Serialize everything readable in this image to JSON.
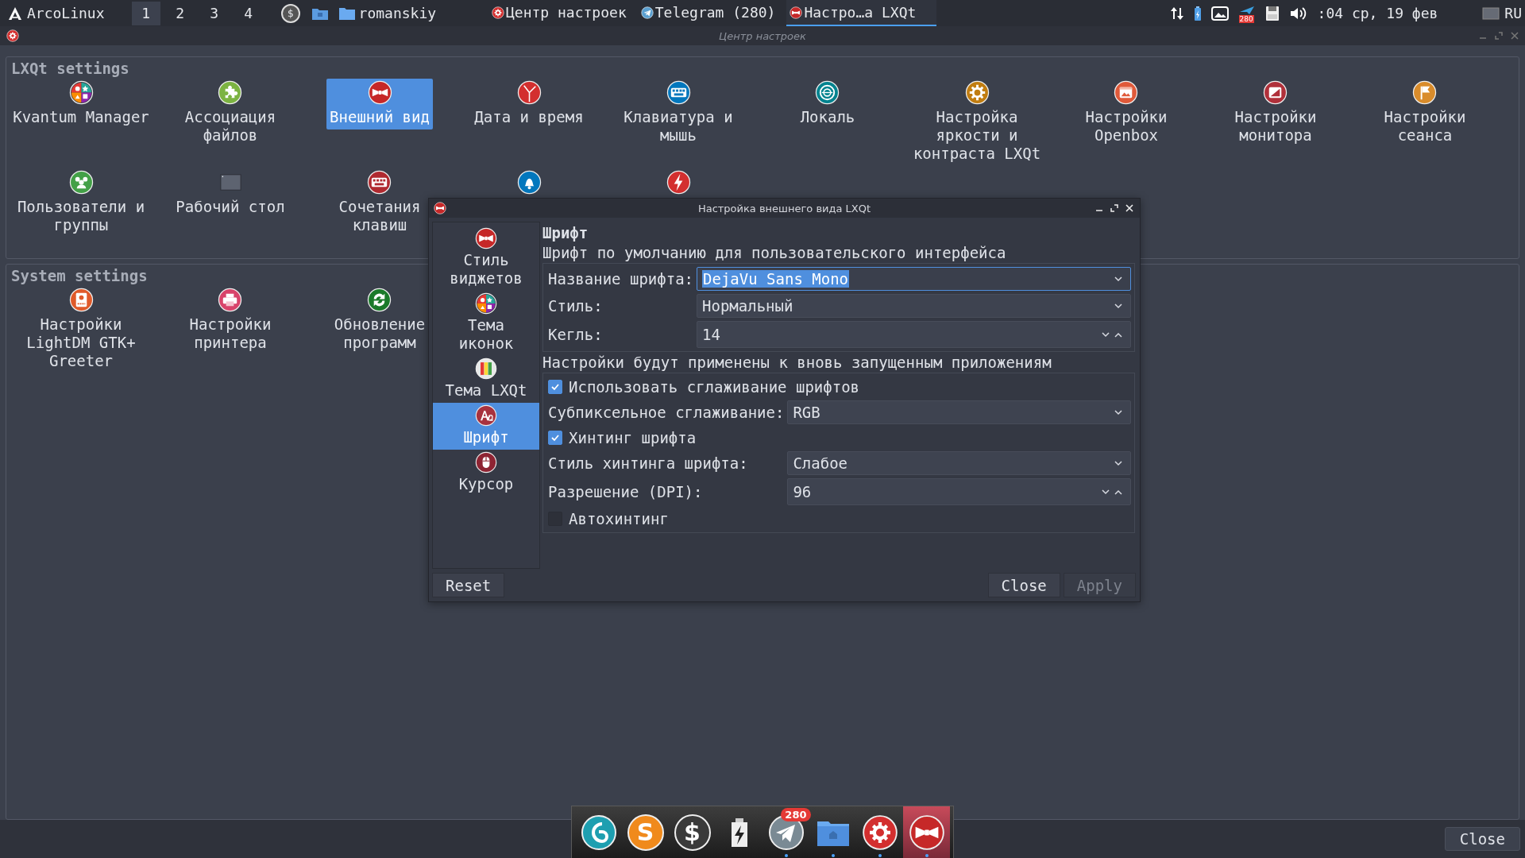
{
  "top_panel": {
    "launcher": "ArcoLinux",
    "workspaces": [
      {
        "label": "1",
        "selected": true
      },
      {
        "label": "2",
        "selected": false
      },
      {
        "label": "3",
        "selected": false
      },
      {
        "label": "4",
        "selected": false
      }
    ],
    "quick_launch": [
      {
        "kind": "terminal",
        "glyph": "$"
      },
      {
        "kind": "folder"
      }
    ],
    "folder": "romanskiy",
    "tasks": [
      {
        "label": "Центр настроек",
        "kind": "settings",
        "selected": false
      },
      {
        "label": "Telegram (280)",
        "kind": "telegram",
        "selected": false
      },
      {
        "label": "Настро…а LXQt",
        "kind": "appearance",
        "selected": true
      }
    ],
    "tray": [
      {
        "kind": "network"
      },
      {
        "kind": "battery"
      },
      {
        "kind": "screen"
      },
      {
        "kind": "telegram",
        "badge": "280"
      },
      {
        "kind": "drive"
      },
      {
        "kind": "volume"
      }
    ],
    "clock": ":04 ср, 19 фев",
    "keyboard_layout": "RU"
  },
  "window": {
    "title": "Центр настроек",
    "footer_button": "Close"
  },
  "groups": [
    {
      "title": "LXQt settings",
      "items": [
        {
          "label": "Kvantum Manager",
          "kind": "kvantum",
          "selected": false
        },
        {
          "label": "Ассоциация\nфайлов",
          "kind": "puzzle",
          "selected": false
        },
        {
          "label": "Внешний вид",
          "kind": "appearance",
          "selected": true
        },
        {
          "label": "Дата и время",
          "kind": "clock",
          "selected": false
        },
        {
          "label": "Клавиатура и\nмышь",
          "kind": "keyboard",
          "selected": false
        },
        {
          "label": "Локаль",
          "kind": "locale",
          "selected": false
        },
        {
          "label": "Настройка\nяркости и\nконтраста LXQt",
          "kind": "brightness",
          "selected": false
        },
        {
          "label": "Настройки\nOpenbox",
          "kind": "openbox",
          "selected": false
        },
        {
          "label": "Настройки\nмонитора",
          "kind": "monitor",
          "selected": false
        },
        {
          "label": "Настройки\nсеанса",
          "kind": "session",
          "selected": false
        },
        {
          "label": "Пользователи и\nгруппы",
          "kind": "users",
          "selected": false
        },
        {
          "label": "Рабочий стол",
          "kind": "desktop",
          "selected": false
        },
        {
          "label": "Сочетания\nклавиш",
          "kind": "shortcuts",
          "selected": false
        },
        {
          "kind": "bell",
          "selected": false
        },
        {
          "kind": "power",
          "selected": false
        }
      ]
    },
    {
      "title": "System settings",
      "items": [
        {
          "label": "Настройки\nLightDM GTK+\nGreeter",
          "kind": "lightdm",
          "selected": false
        },
        {
          "label": "Настройки\nпринтера",
          "kind": "printer",
          "selected": false
        },
        {
          "label": "Обновление\nпрограмм",
          "kind": "update",
          "selected": false
        }
      ]
    }
  ],
  "dialog": {
    "title": "Настройка внешнего вида LXQt",
    "sidebar": [
      {
        "label": "Стиль\nвиджетов",
        "kind": "appearance",
        "selected": false
      },
      {
        "label": "Тема\nиконок",
        "kind": "kvantum",
        "selected": false
      },
      {
        "label": "Тема LXQt",
        "kind": "theme",
        "selected": false
      },
      {
        "label": "Шрифт",
        "kind": "font",
        "selected": true
      },
      {
        "label": "Курсор",
        "kind": "cursor",
        "selected": false
      }
    ],
    "heading": "Шрифт",
    "subheading": "Шрифт по умолчанию для пользовательского интерфейса",
    "font_rows": [
      {
        "kind": "combo",
        "label": "Название шрифта:",
        "value": "DejaVu Sans Mono",
        "focused": true
      },
      {
        "kind": "combo",
        "label": "Стиль:",
        "value": "Нормальный",
        "focused": false
      },
      {
        "kind": "spin",
        "label": "Кегль:",
        "value": "14",
        "focused": false
      }
    ],
    "note": "Настройки будут применены к вновь запущенным приложениям",
    "render_rows": [
      {
        "kind": "checkbox",
        "label": "Использовать сглаживание шрифтов",
        "checked": true
      },
      {
        "kind": "combo",
        "label": "Субпиксельное сглаживание:",
        "value": "RGB",
        "focused": false
      },
      {
        "kind": "checkbox",
        "label": "Хинтинг шрифта",
        "checked": true
      },
      {
        "kind": "combo",
        "label": "Стиль хинтинга шрифта:",
        "value": "Слабое",
        "focused": false
      },
      {
        "kind": "spin",
        "label": "Разрешение (DPI):",
        "value": "96",
        "focused": false
      },
      {
        "kind": "checkbox",
        "label": "Автохинтинг",
        "checked": false
      }
    ],
    "left_buttons": [
      {
        "label": "Reset",
        "disabled": false
      }
    ],
    "right_buttons": [
      {
        "label": "Close",
        "disabled": false
      },
      {
        "label": "Apply",
        "disabled": true
      }
    ]
  },
  "dock": [
    {
      "kind": "swirl",
      "running": false,
      "selected": false
    },
    {
      "kind": "letter",
      "glyph": "S",
      "running": false,
      "selected": false
    },
    {
      "kind": "terminal",
      "glyph": "$",
      "running": false,
      "selected": false
    },
    {
      "kind": "power",
      "running": false,
      "selected": false
    },
    {
      "kind": "telegram",
      "badge": "280",
      "running": true,
      "selected": false
    },
    {
      "kind": "folder",
      "running": true,
      "selected": false
    },
    {
      "kind": "settings",
      "running": true,
      "selected": false
    },
    {
      "kind": "appearance",
      "running": true,
      "selected": true
    }
  ]
}
